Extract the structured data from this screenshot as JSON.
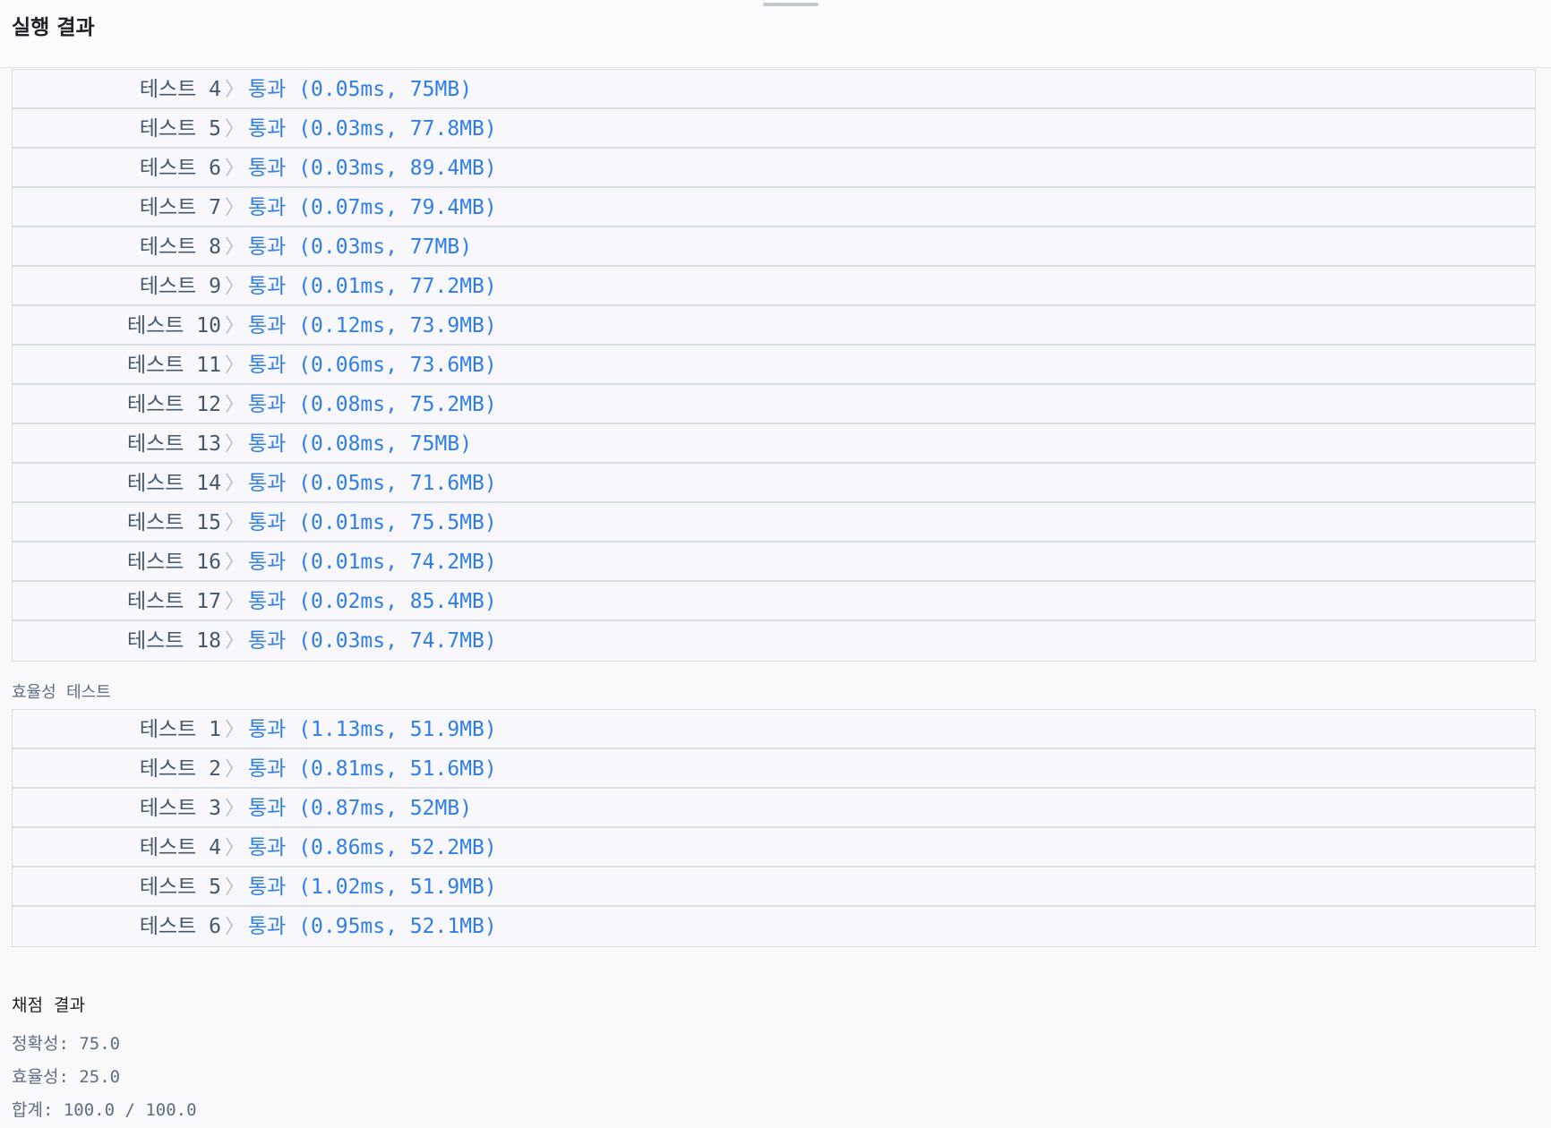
{
  "panel_title": "실행 결과",
  "chevron": "〉",
  "accuracy_results": [
    {
      "label": "테스트 4",
      "status": "통과",
      "detail": "(0.05ms, 75MB)"
    },
    {
      "label": "테스트 5",
      "status": "통과",
      "detail": "(0.03ms, 77.8MB)"
    },
    {
      "label": "테스트 6",
      "status": "통과",
      "detail": "(0.03ms, 89.4MB)"
    },
    {
      "label": "테스트 7",
      "status": "통과",
      "detail": "(0.07ms, 79.4MB)"
    },
    {
      "label": "테스트 8",
      "status": "통과",
      "detail": "(0.03ms, 77MB)"
    },
    {
      "label": "테스트 9",
      "status": "통과",
      "detail": "(0.01ms, 77.2MB)"
    },
    {
      "label": "테스트 10",
      "status": "통과",
      "detail": "(0.12ms, 73.9MB)"
    },
    {
      "label": "테스트 11",
      "status": "통과",
      "detail": "(0.06ms, 73.6MB)"
    },
    {
      "label": "테스트 12",
      "status": "통과",
      "detail": "(0.08ms, 75.2MB)"
    },
    {
      "label": "테스트 13",
      "status": "통과",
      "detail": "(0.08ms, 75MB)"
    },
    {
      "label": "테스트 14",
      "status": "통과",
      "detail": "(0.05ms, 71.6MB)"
    },
    {
      "label": "테스트 15",
      "status": "통과",
      "detail": "(0.01ms, 75.5MB)"
    },
    {
      "label": "테스트 16",
      "status": "통과",
      "detail": "(0.01ms, 74.2MB)"
    },
    {
      "label": "테스트 17",
      "status": "통과",
      "detail": "(0.02ms, 85.4MB)"
    },
    {
      "label": "테스트 18",
      "status": "통과",
      "detail": "(0.03ms, 74.7MB)"
    }
  ],
  "efficiency_section_label": "효율성  테스트",
  "efficiency_results": [
    {
      "label": "테스트 1",
      "status": "통과",
      "detail": "(1.13ms, 51.9MB)"
    },
    {
      "label": "테스트 2",
      "status": "통과",
      "detail": "(0.81ms, 51.6MB)"
    },
    {
      "label": "테스트 3",
      "status": "통과",
      "detail": "(0.87ms, 52MB)"
    },
    {
      "label": "테스트 4",
      "status": "통과",
      "detail": "(0.86ms, 52.2MB)"
    },
    {
      "label": "테스트 5",
      "status": "통과",
      "detail": "(1.02ms, 51.9MB)"
    },
    {
      "label": "테스트 6",
      "status": "통과",
      "detail": "(0.95ms, 52.1MB)"
    }
  ],
  "grading": {
    "title": "채점  결과",
    "accuracy": "정확성: 75.0",
    "efficiency": "효율성: 25.0",
    "total": "합계: 100.0 / 100.0"
  },
  "colors": {
    "pass": "#2f7ee9",
    "label": "#44576c",
    "border": "#d7dde5"
  }
}
